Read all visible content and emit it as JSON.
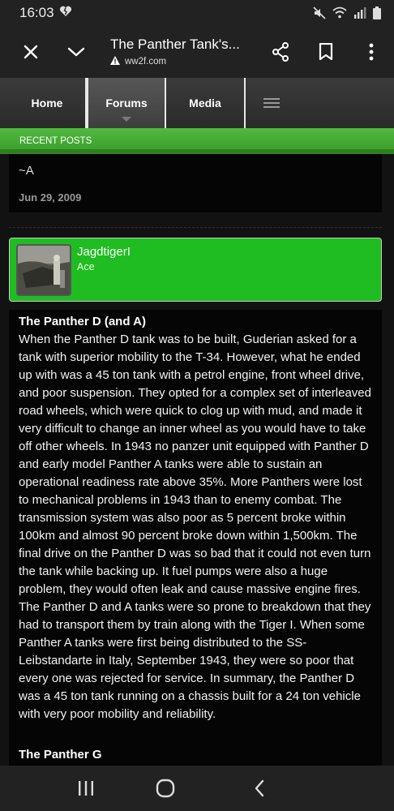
{
  "status_bar": {
    "time": "16:03",
    "icons": [
      "heart-broken-icon",
      "mute-icon",
      "wifi-icon",
      "signal-icon",
      "battery-icon"
    ]
  },
  "browser": {
    "page_title": "The Panther Tank's...",
    "domain": "ww2f.com",
    "icons": [
      "close-icon",
      "chevron-down-icon",
      "warning-icon",
      "share-icon",
      "bookmark-icon",
      "more-vert-icon"
    ]
  },
  "site_nav": {
    "tabs": [
      {
        "label": "Home"
      },
      {
        "label": "Forums"
      },
      {
        "label": "Media"
      }
    ],
    "menu_icon": "hamburger-icon",
    "section_label": "RECENT POSTS"
  },
  "previous_post": {
    "signature": "~A",
    "date": "Jun 29, 2009"
  },
  "post": {
    "username": "JagdtigerI",
    "user_title": "Ace",
    "heading": "The Panther D (and A)",
    "body": "When the Panther D tank was to be built, Guderian asked for a tank with superior mobility to the T-34. However, what he ended up with was a 45 ton tank with a petrol engine, front wheel drive, and poor suspension. They opted for a complex set of interleaved road wheels, which were quick to clog up with mud, and made it very difficult to change an inner wheel as you would have to take off other wheels. In 1943 no panzer unit equipped with Panther D and early model Panther A tanks were able to sustain an operational readiness rate above 35%. More Panthers were lost to mechanical problems in 1943 than to enemy combat. The transmission system was also poor as 5 percent broke within 100km and almost 90 percent broke down within 1,500km. The final drive on the Panther D was so bad that it could not even turn the tank while backing up. It fuel pumps were also a huge problem, they would often leak and cause massive engine fires. The Panther D and A tanks were so prone to breakdown that they had to transport them by train along with the Tiger I. When some Panther A tanks were first being distributed to the SS-Leibstandarte in Italy, September 1943, they were so poor that every one was rejected for service. In summary, the Panther D was a 45 ton tank running on a chassis built for a 24 ton vehicle with very poor mobility and reliability.",
    "next_heading": "The Panther G"
  },
  "android_nav": {
    "icons": [
      "recent-apps-icon",
      "home-icon",
      "back-icon"
    ]
  },
  "colors": {
    "accent_green": "#1fbd21",
    "band_green": "#56c245",
    "background": "#121212"
  }
}
